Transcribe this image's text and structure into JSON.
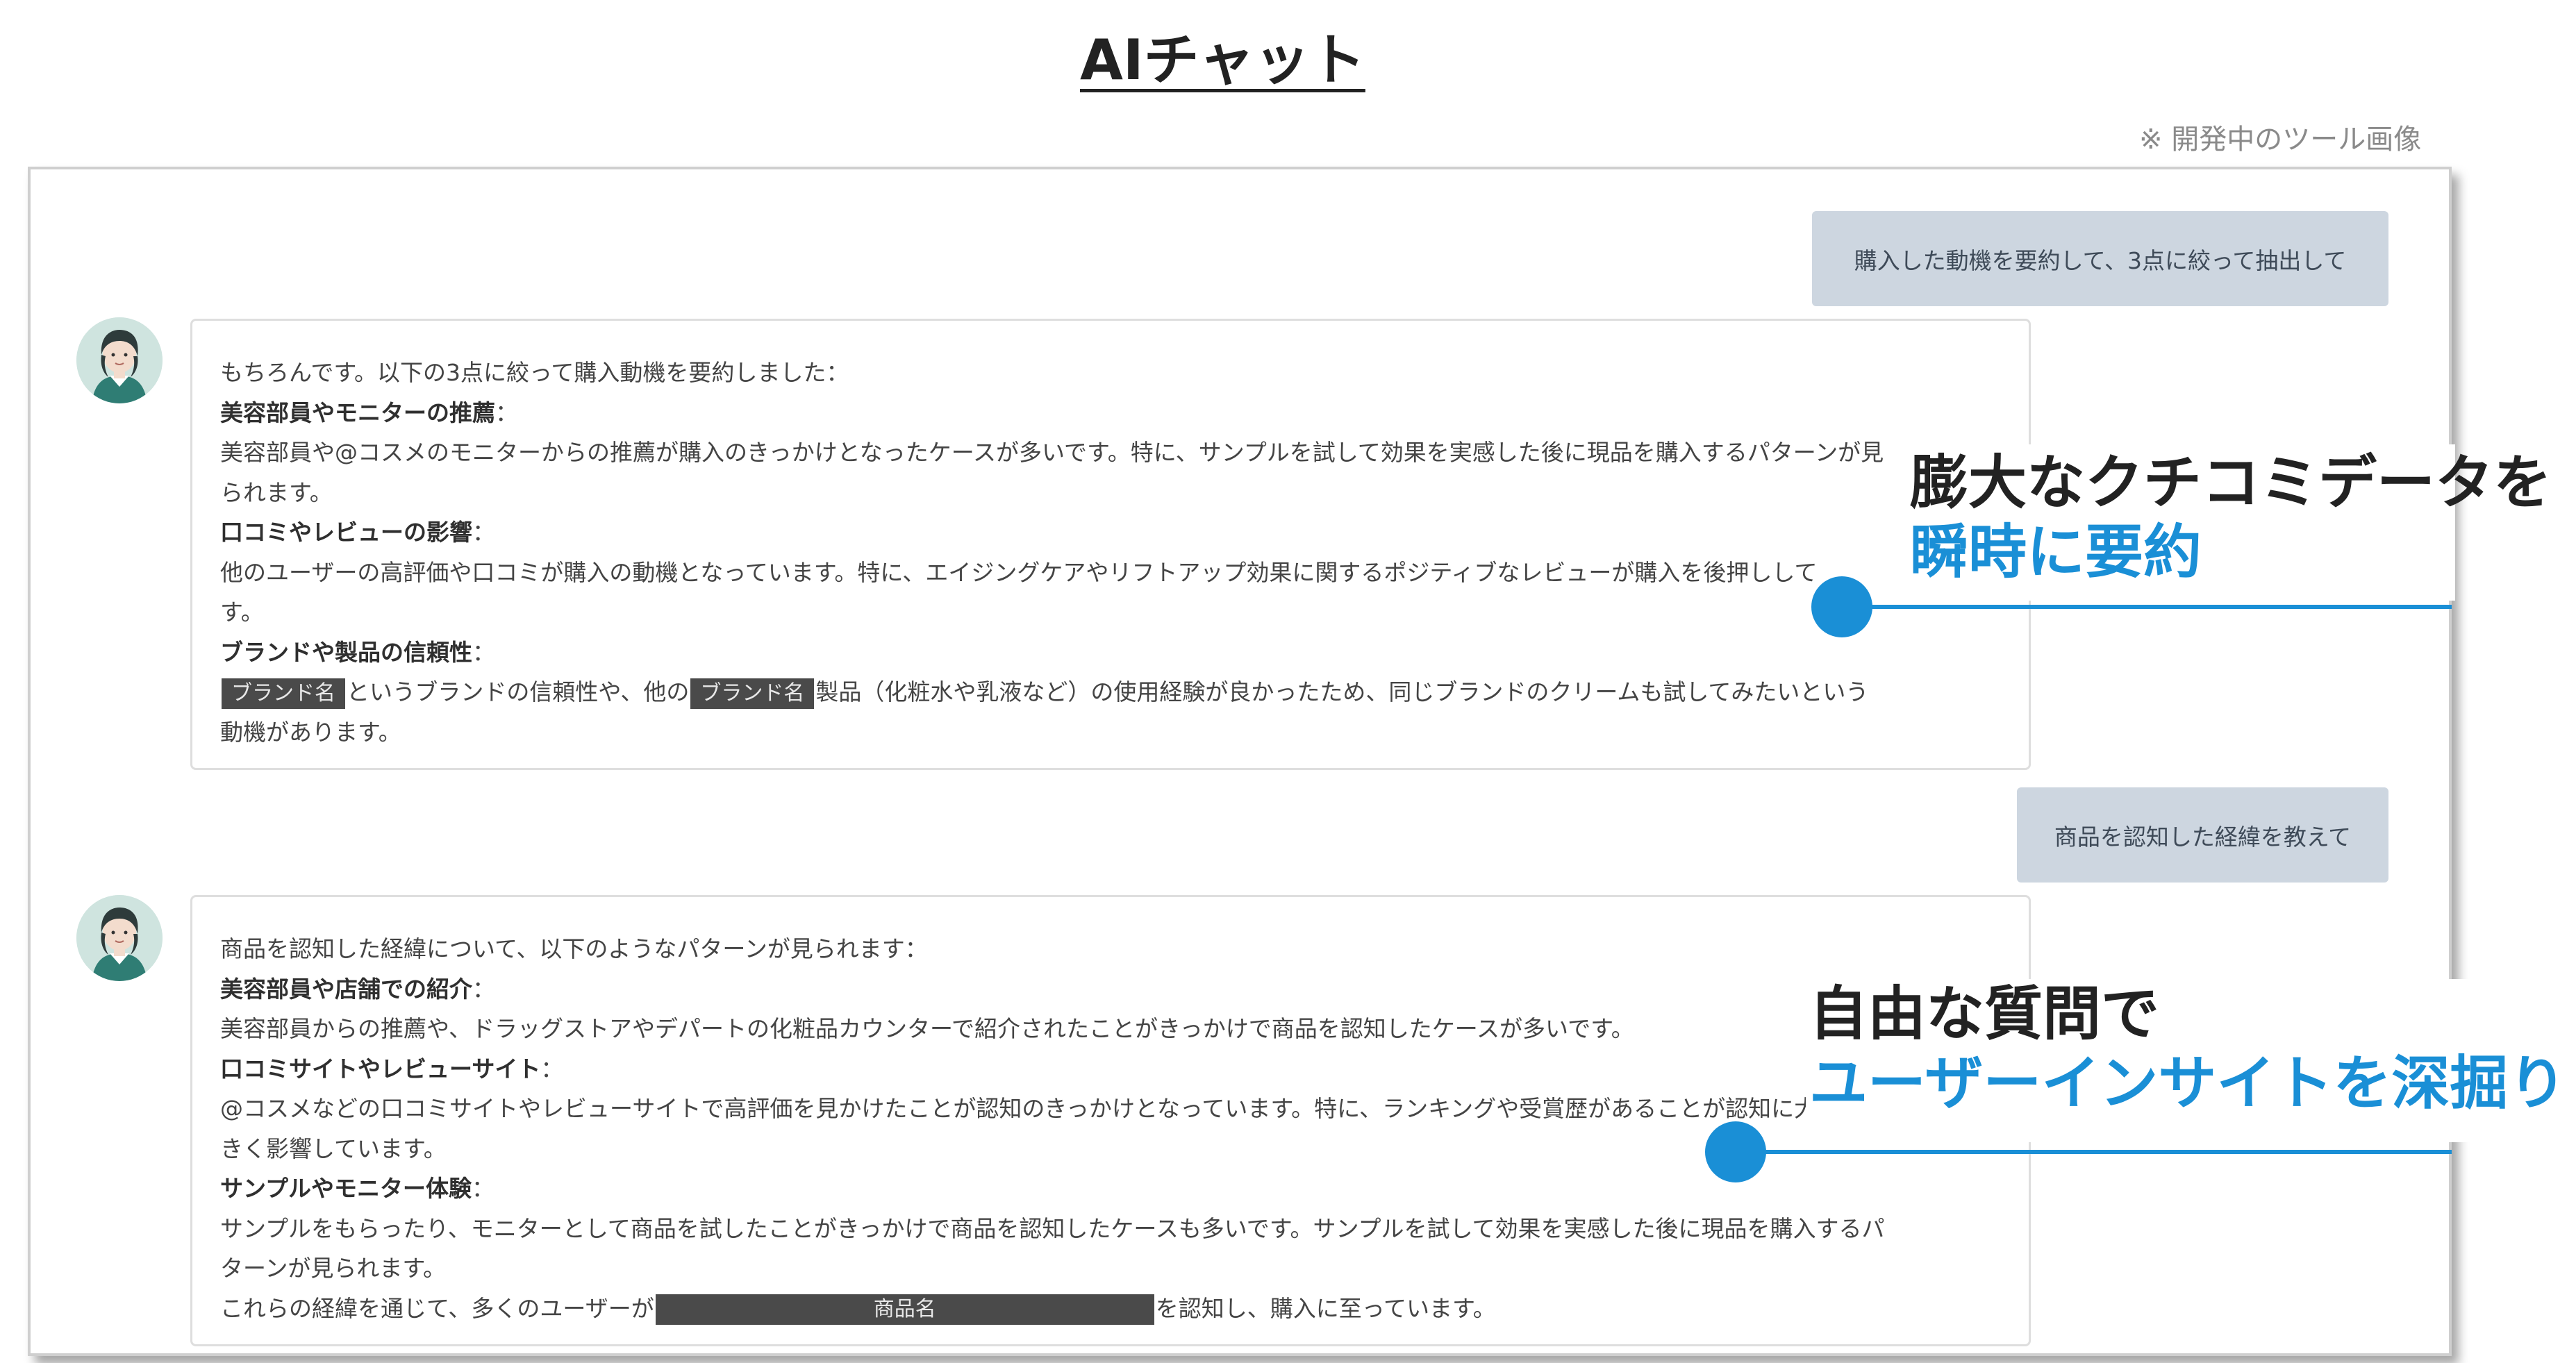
{
  "page": {
    "title": "AIチャット",
    "note": "※ 開発中のツール画像"
  },
  "chat": {
    "user_message_1": "購入した動機を要約して、3点に絞って抽出して",
    "ai_response_1": {
      "intro": "もちろんです。以下の3点に絞って購入動機を要約しました：",
      "point1_title": "美容部員やモニターの推薦",
      "colon": "：",
      "point1_body_1": "美容部員や@コスメのモニターからの推薦が購入のきっかけとなったケースが多いです。特に、サンプルを試して効果を実感した後に現品を購入するパターンが見",
      "point1_body_2": "られます。",
      "point2_title": "口コミやレビューの影響",
      "point2_body_1": "他のユーザーの高評価や口コミが購入の動機となっています。特に、エイジングケアやリフトアップ効果に関するポジティブなレビューが購入を後押しして",
      "point2_body_2": "す。",
      "point3_title": "ブランドや製品の信頼性",
      "redact_brand": "ブランド名",
      "point3_body_a": "というブランドの信頼性や、他の",
      "point3_body_b": "製品（化粧水や乳液など）の使用経験が良かったため、同じブランドのクリームも試してみたいという",
      "point3_body_2": "動機があります。"
    },
    "user_message_2": "商品を認知した経緯を教えて",
    "ai_response_2": {
      "intro": "商品を認知した経緯について、以下のようなパターンが見られます：",
      "point1_title": "美容部員や店舗での紹介",
      "colon": "：",
      "point1_body": "美容部員からの推薦や、ドラッグストアやデパートの化粧品カウンターで紹介されたことがきっかけで商品を認知したケースが多いです。",
      "point2_title": "口コミサイトやレビューサイト",
      "point2_body_1": "@コスメなどの口コミサイトやレビューサイトで高評価を見かけたことが認知のきっかけとなっています。特に、ランキングや受賞歴があることが認知に大",
      "point2_body_2": "きく影響しています。",
      "point3_title": "サンプルやモニター体験",
      "point3_body_1": "サンプルをもらったり、モニターとして商品を試したことがきっかけで商品を認知したケースも多いです。サンプルを試して効果を実感した後に現品を購入するパ",
      "point3_body_2": "ターンが見られます。",
      "summary_a": "これらの経緯を通じて、多くのユーザーが",
      "redact_product": "商品名",
      "summary_b": "を認知し、購入に至っています。"
    }
  },
  "callouts": {
    "callout1_line1": "膨大なクチコミデータを",
    "callout1_line2": "瞬時に要約",
    "callout2_line1": "自由な質問で",
    "callout2_line2": "ユーザーインサイトを深掘り",
    "accent_color": "#1a8fd6"
  },
  "icons": {
    "avatar": "woman-avatar-icon"
  }
}
